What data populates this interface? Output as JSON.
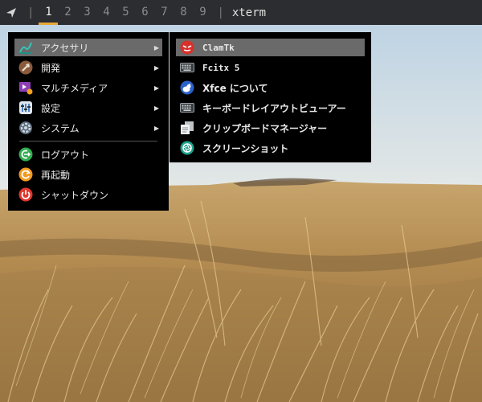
{
  "panel": {
    "launcher_icon": "paper-plane-icon",
    "separator": "|",
    "workspaces": [
      "1",
      "2",
      "3",
      "4",
      "5",
      "6",
      "7",
      "8",
      "9"
    ],
    "active_workspace": "1",
    "window_title": "xterm",
    "accent": "#e6a93a"
  },
  "main_menu": {
    "items": [
      {
        "label": "アクセサリ",
        "icon": "accessories-icon",
        "has_submenu": true,
        "highlighted": true
      },
      {
        "label": "開発",
        "icon": "development-icon",
        "has_submenu": true
      },
      {
        "label": "マルチメディア",
        "icon": "multimedia-icon",
        "has_submenu": true
      },
      {
        "label": "設定",
        "icon": "settings-icon",
        "has_submenu": true
      },
      {
        "label": "システム",
        "icon": "system-icon",
        "has_submenu": true
      },
      {
        "label": "ログアウト",
        "icon": "logout-icon"
      },
      {
        "label": "再起動",
        "icon": "restart-icon"
      },
      {
        "label": "シャットダウン",
        "icon": "shutdown-icon"
      }
    ],
    "submenu_arrow": "▶"
  },
  "submenu": {
    "items": [
      {
        "label": "ClamTk",
        "icon": "clamtk-icon",
        "highlighted": true
      },
      {
        "label": "Fcitx 5",
        "icon": "keyboard-icon"
      },
      {
        "label": "Xfce について",
        "icon": "xfce-mouse-icon"
      },
      {
        "label": "キーボードレイアウトビューアー",
        "icon": "keyboard-layout-icon"
      },
      {
        "label": "クリップボードマネージャー",
        "icon": "clipboard-icon"
      },
      {
        "label": "スクリーンショット",
        "icon": "screenshot-icon"
      }
    ]
  }
}
